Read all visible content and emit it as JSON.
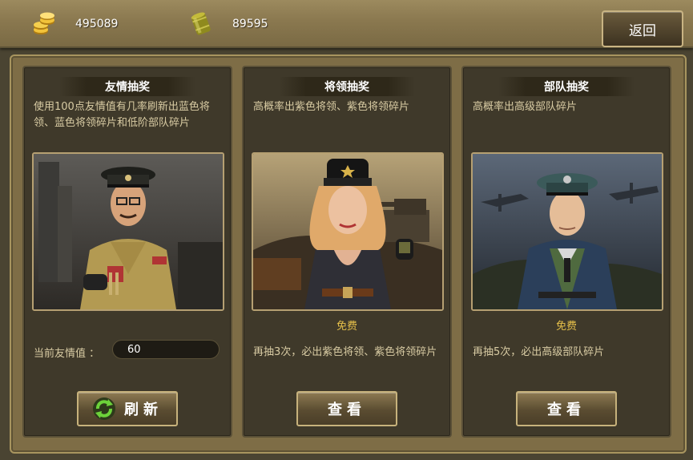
{
  "currency": {
    "gold_icon": "gold-coins-icon",
    "gold_amount": "495089",
    "oil_icon": "fuel-barrel-icon",
    "oil_amount": "89595"
  },
  "header": {
    "back_label": "返回"
  },
  "panels": [
    {
      "title": "友情抽奖",
      "description": "使用100点友情值有几率刷新出蓝色将领、蓝色将领碎片和低阶部队碎片",
      "friendship_label": "当前友情值 ：",
      "friendship_value": "60",
      "button_label": "刷新",
      "button_icon": "refresh-icon"
    },
    {
      "title": "将领抽奖",
      "description": "高概率出紫色将领、紫色将领碎片",
      "free_label": "免费",
      "note": "再抽3次，必出紫色将领、紫色将领碎片",
      "button_label": "查看"
    },
    {
      "title": "部队抽奖",
      "description": "高概率出高级部队碎片",
      "free_label": "免费",
      "note": "再抽5次，必出高级部队碎片",
      "button_label": "查看"
    }
  ],
  "colors": {
    "accent_gold": "#e6c04a",
    "panel_bg": "#3f392a",
    "frame_bg": "#7e6d46"
  }
}
